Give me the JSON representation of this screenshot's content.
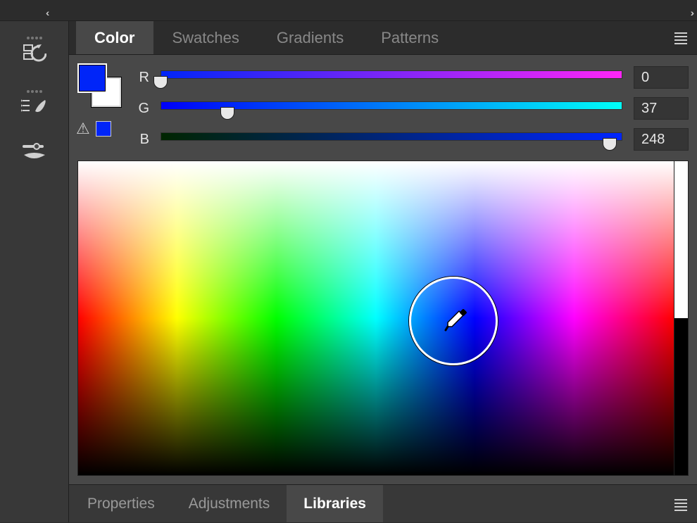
{
  "tabs": {
    "color": "Color",
    "swatches": "Swatches",
    "gradients": "Gradients",
    "patterns": "Patterns"
  },
  "channels": {
    "r": {
      "label": "R",
      "value": "0",
      "pct": 0
    },
    "g": {
      "label": "G",
      "value": "37",
      "pct": 14.5
    },
    "b": {
      "label": "B",
      "value": "248",
      "pct": 97.3
    }
  },
  "foreground_color": "#0025F8",
  "background_color": "#FFFFFF",
  "spectrum": {
    "picker_x_pct": 63,
    "picker_y_pct": 51
  },
  "bottom_tabs": {
    "properties": "Properties",
    "adjustments": "Adjustments",
    "libraries": "Libraries"
  }
}
